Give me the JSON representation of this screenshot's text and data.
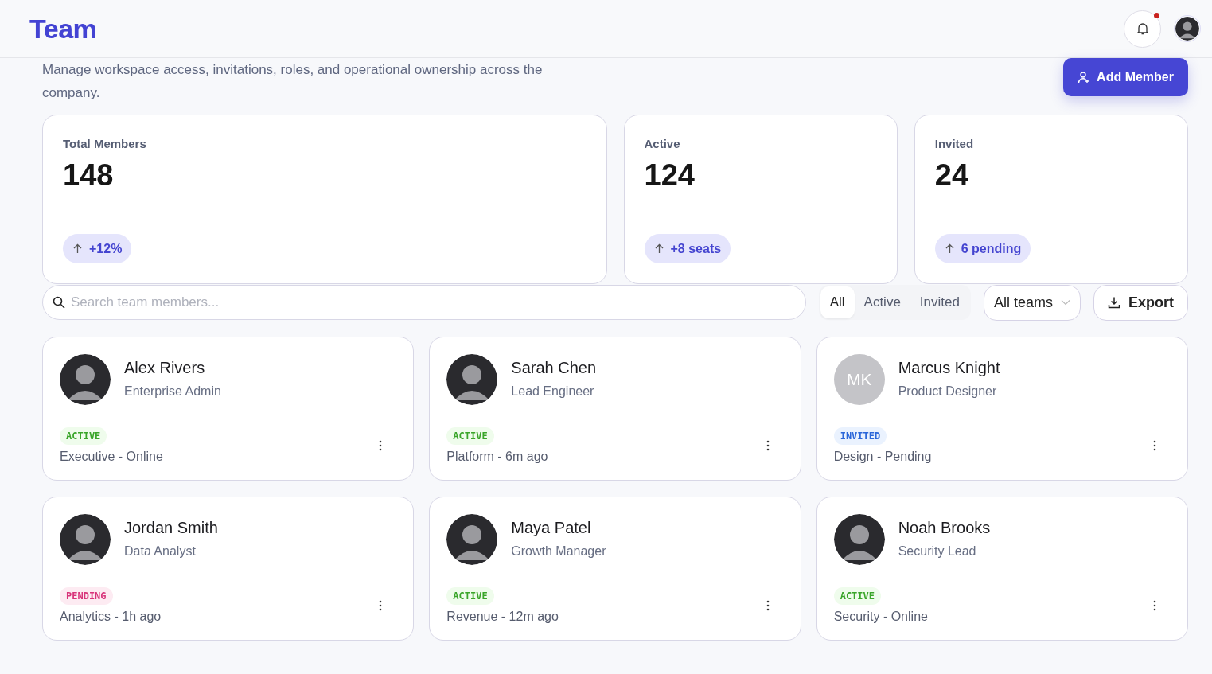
{
  "header": {
    "title": "Team",
    "notification": {
      "unread": true
    },
    "user_avatar": {
      "kind": "photo"
    }
  },
  "description": "Manage workspace access, invitations, roles, and operational ownership across the company.",
  "add_button": {
    "label": "Add Member"
  },
  "stats": [
    {
      "label": "Total Members",
      "value": "148",
      "delta": "+12%"
    },
    {
      "label": "Active",
      "value": "124",
      "delta": "+8 seats"
    },
    {
      "label": "Invited",
      "value": "24",
      "delta": "6 pending"
    }
  ],
  "search": {
    "placeholder": "Search team members..."
  },
  "filters": [
    {
      "label": "All",
      "selected": true
    },
    {
      "label": "Active",
      "selected": false
    },
    {
      "label": "Invited",
      "selected": false
    }
  ],
  "team_select": {
    "value": "All teams"
  },
  "export_button": {
    "label": "Export"
  },
  "members": [
    {
      "name": "Alex Rivers",
      "role": "Enterprise Admin",
      "status": {
        "kind": "active",
        "label": "ACTIVE"
      },
      "meta": "Executive - Online",
      "avatar": {
        "kind": "photo"
      }
    },
    {
      "name": "Sarah Chen",
      "role": "Lead Engineer",
      "status": {
        "kind": "active",
        "label": "ACTIVE"
      },
      "meta": "Platform - 6m ago",
      "avatar": {
        "kind": "photo"
      }
    },
    {
      "name": "Marcus Knight",
      "role": "Product Designer",
      "status": {
        "kind": "invited",
        "label": "INVITED"
      },
      "meta": "Design - Pending",
      "avatar": {
        "kind": "initials",
        "text": "MK"
      }
    },
    {
      "name": "Jordan Smith",
      "role": "Data Analyst",
      "status": {
        "kind": "pending",
        "label": "PENDING"
      },
      "meta": "Analytics - 1h ago",
      "avatar": {
        "kind": "photo"
      }
    },
    {
      "name": "Maya Patel",
      "role": "Growth Manager",
      "status": {
        "kind": "active",
        "label": "ACTIVE"
      },
      "meta": "Revenue - 12m ago",
      "avatar": {
        "kind": "photo"
      }
    },
    {
      "name": "Noah Brooks",
      "role": "Security Lead",
      "status": {
        "kind": "active",
        "label": "ACTIVE"
      },
      "meta": "Security - Online",
      "avatar": {
        "kind": "photo"
      }
    }
  ]
}
